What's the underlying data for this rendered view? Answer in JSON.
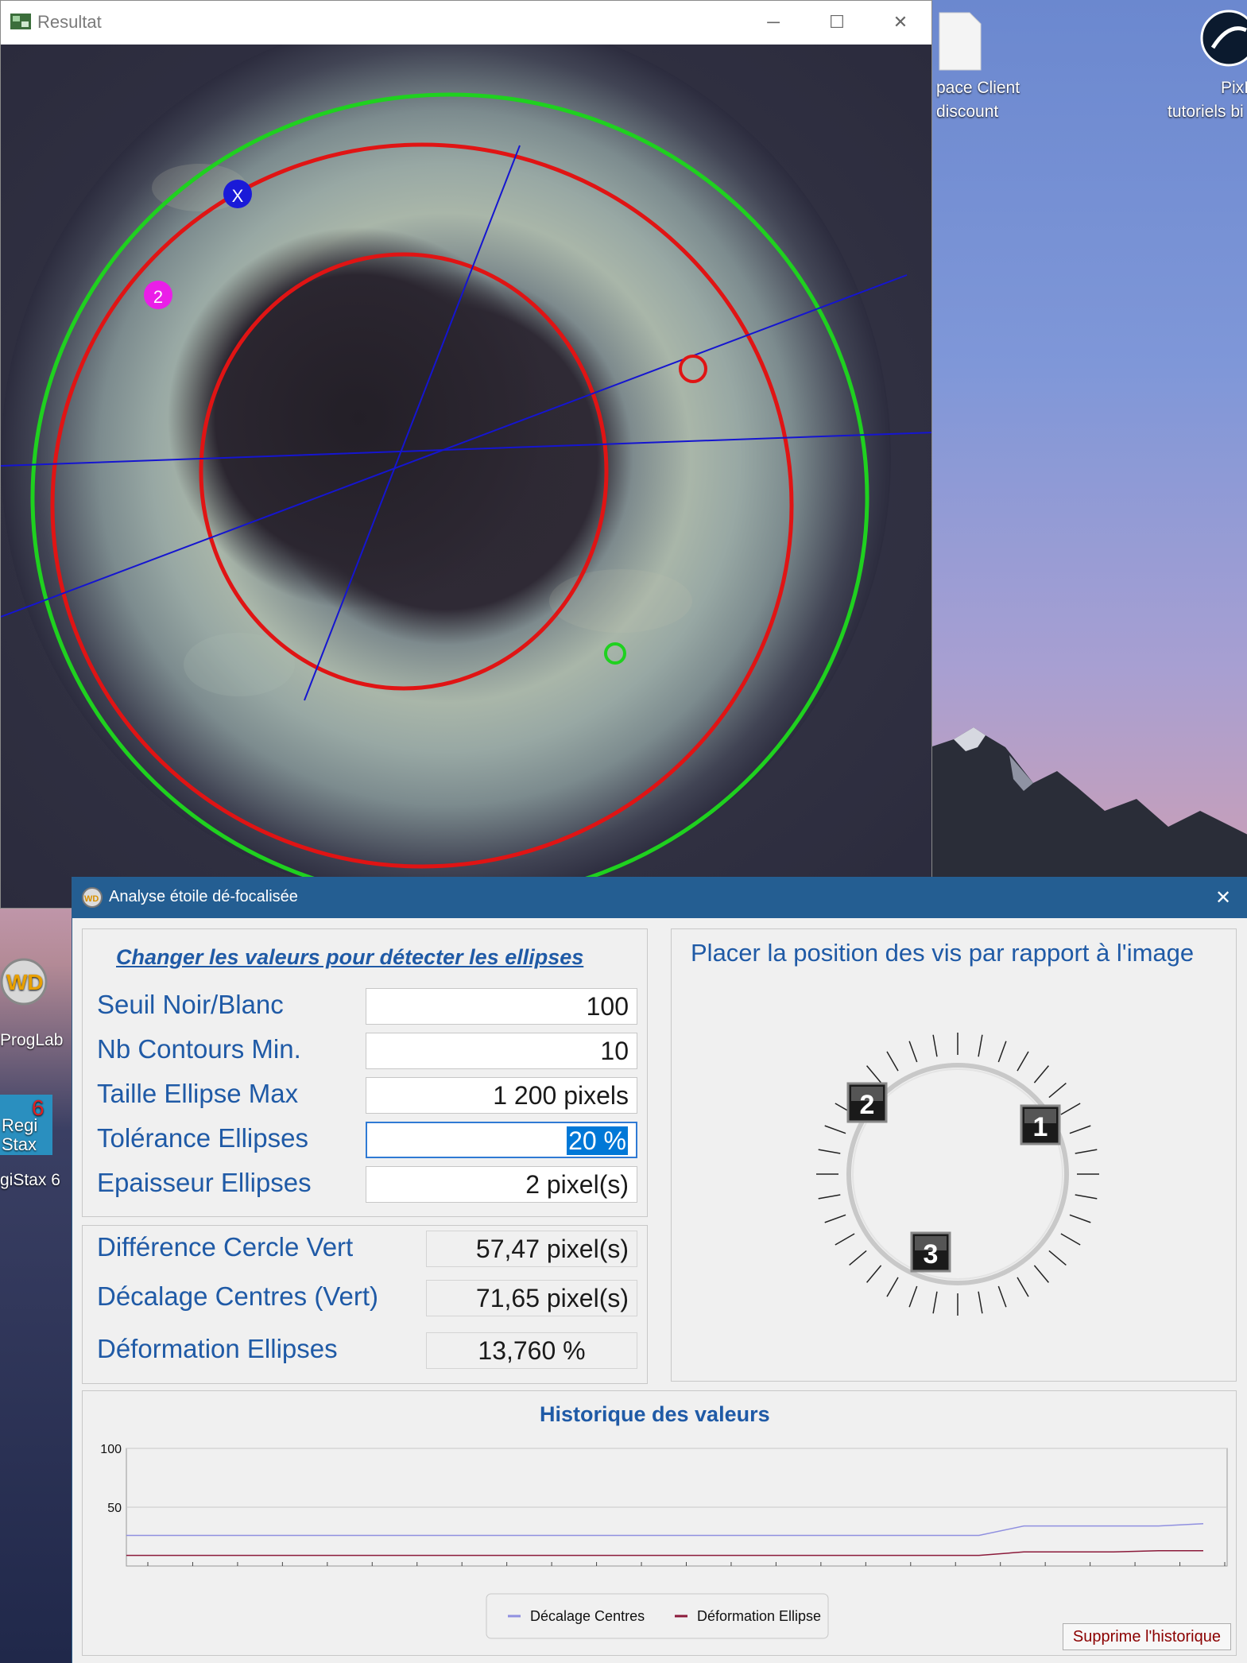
{
  "desktop": {
    "icons": [
      {
        "label_line1": "pace Client",
        "label_line2": "discount"
      },
      {
        "label_line1": "PixInsig",
        "label_line2": "tutoriels bi"
      },
      {
        "label_line1": "ProgLab"
      },
      {
        "label_line1": "giStax 6"
      }
    ]
  },
  "result_window": {
    "title": "Resultat",
    "markers": {
      "blue": "X",
      "magenta": "2"
    }
  },
  "dialog": {
    "title": "Analyse étoile dé-focalisée",
    "settings": {
      "header": "Changer les valeurs pour détecter les ellipses",
      "fields": [
        {
          "label": "Seuil Noir/Blanc",
          "value": "100"
        },
        {
          "label": "Nb Contours Min.",
          "value": "10"
        },
        {
          "label": "Taille Ellipse Max",
          "value": "1 200 pixels"
        },
        {
          "label": "Tolérance Ellipses",
          "value": "20 %"
        },
        {
          "label": "Epaisseur Ellipses",
          "value": "2 pixel(s)"
        }
      ]
    },
    "results": [
      {
        "label": "Différence Cercle Vert",
        "value": "57,47 pixel(s)"
      },
      {
        "label": "Décalage Centres (Vert)",
        "value": "71,65 pixel(s)"
      },
      {
        "label": "Déformation Ellipses",
        "value": "13,760 %"
      }
    ],
    "screw_panel": {
      "title": "Placer la position des vis par rapport à l'image",
      "screws": [
        "1",
        "2",
        "3"
      ]
    },
    "history": {
      "title": "Historique des valeurs",
      "clear_button": "Supprime l'historique"
    }
  },
  "chart_data": {
    "type": "line",
    "title": "Historique des valeurs",
    "yticks": [
      50,
      100
    ],
    "ylim": [
      0,
      100
    ],
    "x": [
      1,
      2,
      3,
      4,
      5,
      6,
      7,
      8,
      9,
      10,
      11,
      12,
      13,
      14,
      15,
      16,
      17,
      18,
      19,
      20,
      21,
      22,
      23,
      24,
      25
    ],
    "series": [
      {
        "name": "Décalage Centres",
        "color": "#9090e0",
        "values": [
          26,
          26,
          26,
          26,
          26,
          26,
          26,
          26,
          26,
          26,
          26,
          26,
          26,
          26,
          26,
          26,
          26,
          26,
          26,
          26,
          34,
          34,
          34,
          34,
          36
        ]
      },
      {
        "name": "Déformation Ellipse",
        "color": "#8b1a3a",
        "values": [
          9,
          9,
          9,
          9,
          9,
          9,
          9,
          9,
          9,
          9,
          9,
          9,
          9,
          9,
          9,
          9,
          9,
          9,
          9,
          9,
          12,
          12,
          12,
          13,
          13
        ]
      }
    ],
    "legend": "bottom-center",
    "grid": true
  }
}
